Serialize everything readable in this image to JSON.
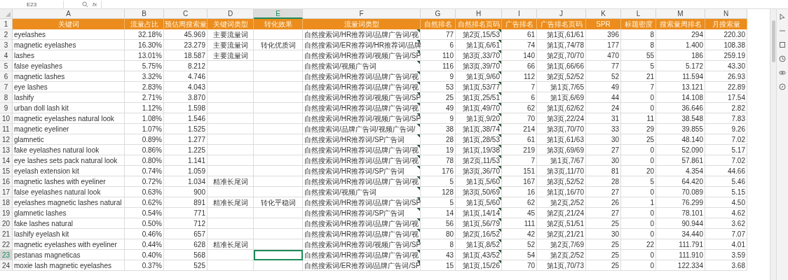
{
  "formula_bar": {
    "name_box": "E23",
    "function_label": "fx"
  },
  "corner_row_label": "1",
  "columns": [
    {
      "letter": "A",
      "heading": "关键词",
      "kind": "text",
      "selected": false,
      "comment_markers": false
    },
    {
      "letter": "B",
      "heading": "流量占比",
      "kind": "number",
      "selected": false,
      "comment_markers": false
    },
    {
      "letter": "C",
      "heading": "预估周搜索量",
      "kind": "number",
      "selected": false,
      "comment_markers": false
    },
    {
      "letter": "D",
      "heading": "关键词类型",
      "kind": "label",
      "selected": false,
      "comment_markers": false
    },
    {
      "letter": "E",
      "heading": "转化效果",
      "kind": "label",
      "selected": true,
      "comment_markers": false
    },
    {
      "letter": "F",
      "heading": "流量词类型",
      "kind": "text",
      "selected": false,
      "comment_markers": true
    },
    {
      "letter": "G",
      "heading": "自然排名",
      "kind": "number",
      "selected": false,
      "comment_markers": false
    },
    {
      "letter": "H",
      "heading": "自然排名页码",
      "kind": "number",
      "selected": false,
      "comment_markers": true
    },
    {
      "letter": "I",
      "heading": "广告排名",
      "kind": "number",
      "selected": false,
      "comment_markers": false
    },
    {
      "letter": "J",
      "heading": "广告排名页码",
      "kind": "number",
      "selected": false,
      "comment_markers": false
    },
    {
      "letter": "K",
      "heading": "SPR",
      "kind": "number",
      "selected": false,
      "comment_markers": false
    },
    {
      "letter": "L",
      "heading": "标题密度",
      "kind": "number",
      "selected": false,
      "comment_markers": false
    },
    {
      "letter": "M",
      "heading": "搜索量周排名",
      "kind": "number",
      "selected": false,
      "comment_markers": false
    },
    {
      "letter": "N",
      "heading": "月搜索量",
      "kind": "number",
      "selected": false,
      "comment_markers": false
    }
  ],
  "rows": [
    {
      "number": "2",
      "selected": false,
      "cells": [
        "eyelashes",
        "32.18%",
        "45.969",
        "主要流量词",
        null,
        "自然搜索词/HR推荐词/品牌广告词/视",
        "77",
        "第2页,15/53",
        "61",
        "第1页,61/61",
        "396",
        "8",
        "294",
        "220.30"
      ]
    },
    {
      "number": "3",
      "selected": false,
      "cells": [
        "magnetic eyelashes",
        "16.30%",
        "23.279",
        "主要流量词",
        "转化优质词",
        "自然搜索词/ER推荐词/HR推荐词/品牌",
        "6",
        "第1页,6/61",
        "74",
        "第1页,74/78",
        "177",
        "8",
        "1.400",
        "108.38"
      ]
    },
    {
      "number": "4",
      "selected": false,
      "cells": [
        "lashes",
        "13.01%",
        "18.587",
        "主要流量词",
        null,
        "自然搜索词/HR推荐词/视频广告词/SP",
        "110",
        "第3页,33/70",
        "140",
        "第2页,70/70",
        "470",
        "55",
        "186",
        "259.19"
      ]
    },
    {
      "number": "5",
      "selected": false,
      "cells": [
        "false eyelashes",
        "5.75%",
        "8.212",
        null,
        null,
        "自然搜索词/视频广告词",
        "116",
        "第3页,39/70",
        "66",
        "第1页,66/66",
        "77",
        "5",
        "5.172",
        "43.30"
      ]
    },
    {
      "number": "6",
      "selected": false,
      "cells": [
        "magnetic lashes",
        "3.32%",
        "4.746",
        null,
        null,
        "自然搜索词/HR推荐词/品牌广告词/视",
        "9",
        "第1页,9/60",
        "112",
        "第2页,52/52",
        "52",
        "21",
        "11.594",
        "26.93"
      ]
    },
    {
      "number": "7",
      "selected": false,
      "cells": [
        "eye lashes",
        "2.83%",
        "4.043",
        null,
        null,
        "自然搜索词/HR推荐词/品牌广告词/视",
        "53",
        "第1页,53/77",
        "7",
        "第1页,7/65",
        "49",
        "7",
        "13.121",
        "22.89"
      ]
    },
    {
      "number": "8",
      "selected": false,
      "cells": [
        "lashify",
        "2.71%",
        "3.870",
        null,
        null,
        "自然搜索词/HR推荐词/视频广告词/SP",
        "25",
        "第1页,25/51",
        "6",
        "第1页,6/69",
        "44",
        "0",
        "14.108",
        "17.54"
      ]
    },
    {
      "number": "9",
      "selected": false,
      "cells": [
        "urban doll lash kit",
        "1.12%",
        "1.598",
        null,
        null,
        "自然搜索词/HR推荐词/品牌广告词/视",
        "49",
        "第1页,49/70",
        "62",
        "第1页,62/62",
        "24",
        "0",
        "36.646",
        "2.82"
      ]
    },
    {
      "number": "10",
      "selected": false,
      "cells": [
        "magnetic eyelashes natural look",
        "1.08%",
        "1.546",
        null,
        null,
        "自然搜索词/HR推荐词/视频广告词/SP",
        "9",
        "第1页,9/20",
        "70",
        "第3页,22/24",
        "31",
        "11",
        "38.548",
        "7.83"
      ]
    },
    {
      "number": "11",
      "selected": false,
      "cells": [
        "magnetic eyeliner",
        "1.07%",
        "1.525",
        null,
        null,
        "自然搜索词/品牌广告词/视频广告词/",
        "38",
        "第1页,38/74",
        "214",
        "第3页,70/70",
        "33",
        "29",
        "39.855",
        "9.26"
      ]
    },
    {
      "number": "12",
      "selected": false,
      "cells": [
        "glamnetic",
        "0.89%",
        "1.277",
        null,
        null,
        "自然搜索词/HR推荐词/SP广告词",
        "28",
        "第1页,28/53",
        "61",
        "第1页,61/63",
        "30",
        "25",
        "48.140",
        "7.02"
      ]
    },
    {
      "number": "13",
      "selected": false,
      "cells": [
        "fake eyelashes natural look",
        "0.86%",
        "1.225",
        null,
        null,
        "自然搜索词/HR推荐词/品牌广告词/视",
        "19",
        "第1页,19/38",
        "219",
        "第3页,69/69",
        "27",
        "0",
        "52.090",
        "5.17"
      ]
    },
    {
      "number": "14",
      "selected": false,
      "cells": [
        "eye lashes sets pack natural look",
        "0.80%",
        "1.141",
        null,
        null,
        "自然搜索词/HR推荐词/品牌广告词/视",
        "78",
        "第2页,11/53",
        "7",
        "第1页,7/67",
        "30",
        "0",
        "57.861",
        "7.02"
      ]
    },
    {
      "number": "15",
      "selected": false,
      "cells": [
        "eyelash extension kit",
        "0.74%",
        "1.059",
        null,
        null,
        "自然搜索词/HR推荐词/SP广告词",
        "176",
        "第3页,36/70",
        "151",
        "第3页,11/70",
        "81",
        "20",
        "4.354",
        "44.66"
      ]
    },
    {
      "number": "16",
      "selected": false,
      "cells": [
        "magnetic lashes with eyeliner",
        "0.72%",
        "1.034",
        "精准长尾词",
        null,
        "自然搜索词/HR推荐词/品牌广告词/视",
        "5",
        "第1页,5/60",
        "167",
        "第3页,52/52",
        "28",
        "5",
        "64.420",
        "5.46"
      ]
    },
    {
      "number": "17",
      "selected": false,
      "cells": [
        "false eyelashes natural look",
        "0.63%",
        "900",
        null,
        null,
        "自然搜索词/视频广告词",
        "128",
        "第3页,50/69",
        "16",
        "第1页,16/70",
        "27",
        "0",
        "70.089",
        "5.15"
      ]
    },
    {
      "number": "18",
      "selected": false,
      "cells": [
        "eyelashes magnetic lashes natural",
        "0.62%",
        "891",
        "精准长尾词",
        "转化平稳词",
        "自然搜索词/HR推荐词/品牌广告词/SP",
        "5",
        "第1页,5/60",
        "62",
        "第2页,2/52",
        "26",
        "1",
        "76.299",
        "4.50"
      ]
    },
    {
      "number": "19",
      "selected": false,
      "cells": [
        "glamnetic lashes",
        "0.54%",
        "771",
        null,
        null,
        "自然搜索词/HR推荐词/SP广告词",
        "14",
        "第1页,14/14",
        "45",
        "第2页,21/24",
        "27",
        "0",
        "78.101",
        "4.62"
      ]
    },
    {
      "number": "20",
      "selected": false,
      "cells": [
        "fake lashes natural",
        "0.50%",
        "712",
        null,
        null,
        "自然搜索词/HR推荐词/品牌广告词/视",
        "56",
        "第1页,56/79",
        "111",
        "第2页,51/51",
        "25",
        "0",
        "90.944",
        "3.62"
      ]
    },
    {
      "number": "21",
      "selected": false,
      "cells": [
        "lashify eyelash kit",
        "0.46%",
        "657",
        null,
        null,
        "自然搜索词/HR推荐词/品牌广告词/视",
        "80",
        "第2页,16/52",
        "42",
        "第2页,21/21",
        "30",
        "0",
        "34.440",
        "7.07"
      ]
    },
    {
      "number": "22",
      "selected": false,
      "cells": [
        "magnetic eyelashes with eyeliner",
        "0.44%",
        "628",
        "精准长尾词",
        null,
        "自然搜索词/HR推荐词/视频广告词/SP",
        "8",
        "第1页,8/52",
        "52",
        "第2页,7/69",
        "25",
        "22",
        "111.791",
        "4.01"
      ]
    },
    {
      "number": "23",
      "selected": true,
      "cells": [
        "pestanas magneticas",
        "0.40%",
        "568",
        null,
        null,
        "自然搜索词/HR推荐词/品牌广告词/视",
        "43",
        "第1页,43/52",
        "54",
        "第2页,2/52",
        "25",
        "0",
        "111.910",
        "3.59"
      ]
    },
    {
      "number": "24",
      "selected": false,
      "cells": [
        "moxie lash magnetic eyelashes",
        "0.37%",
        "525",
        null,
        null,
        "自然搜索词/ER推荐词/品牌广告词/SP",
        "15",
        "第1页,15/26",
        "70",
        "第1页,70/73",
        "25",
        "0",
        "122.334",
        "3.68"
      ]
    }
  ]
}
